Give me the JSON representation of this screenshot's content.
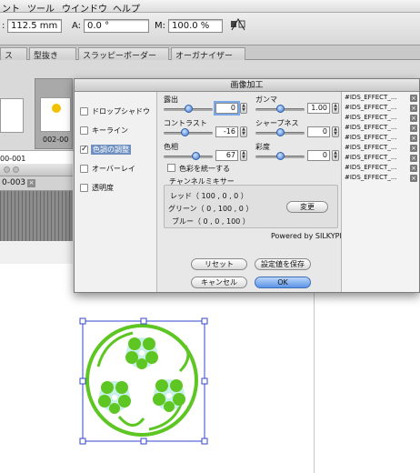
{
  "menubar": {
    "items": [
      "ント",
      "ツール",
      "ウインドウ",
      "ヘルプ"
    ]
  },
  "toolbar": {
    "w_label": ":",
    "w_value": "112.5 mm",
    "angle_label": "A:",
    "angle_value": "0.0 °",
    "scale_label": "M:",
    "scale_value": "100.0 %"
  },
  "tabs": [
    "ス",
    "型抜き",
    "スラッピーボーダー",
    "オーガナイザー"
  ],
  "thumbnails": [
    {
      "label": "00-001"
    },
    {
      "label": "002-00"
    }
  ],
  "document_tab": {
    "label": "0-003"
  },
  "dialog": {
    "title": "画像加工",
    "effects": [
      {
        "label": "ドロップシャドウ",
        "checked": false
      },
      {
        "label": "キーライン",
        "checked": false
      },
      {
        "label": "色調の調整",
        "checked": true
      },
      {
        "label": "オーバーレイ",
        "checked": false
      },
      {
        "label": "透明度",
        "checked": false
      }
    ],
    "controls": {
      "exposure_label": "露出",
      "exposure_value": "0",
      "exposure_level": 0.5,
      "gamma_label": "ガンマ",
      "gamma_value": "1.00",
      "gamma_level": 0.5,
      "contrast_label": "コントラスト",
      "contrast_value": "-16",
      "contrast_level": 0.42,
      "sharpness_label": "シャープネス",
      "sharpness_value": "0",
      "sharpness_level": 0.5,
      "hue_label": "色相",
      "hue_value": "67",
      "hue_level": 0.68,
      "saturation_label": "彩度",
      "saturation_value": "0",
      "saturation_level": 0.5,
      "unify_label": "色彩を統一する"
    },
    "mixer": {
      "title": "チャンネルミキサー",
      "red": "レッド（ 100 ,      0 ,      0 ）",
      "green": "グリーン（    0 ,  100 ,      0 ）",
      "blue": "ブルー（    0 ,      0 ,  100 ）",
      "change_button": "変更"
    },
    "powered_by": "Powered by SILKYPIX",
    "reset_button": "リセット",
    "save_button": "設定値を保存",
    "cancel_button": "キャンセル",
    "ok_button": "OK",
    "presets": [
      "#IDS_EFFECT_...",
      "#IDS_EFFECT_...",
      "#IDS_EFFECT_...",
      "#IDS_EFFECT_...",
      "#IDS_EFFECT_...",
      "#IDS_EFFECT_...",
      "#IDS_EFFECT_...",
      "#IDS_EFFECT_...",
      "#IDS_EFFECT_..."
    ]
  },
  "colors": {
    "accent": "#3f7ad0",
    "clipart": "#5ec622",
    "clipart_light": "#c8f0e8",
    "selection": "#3344cc"
  }
}
